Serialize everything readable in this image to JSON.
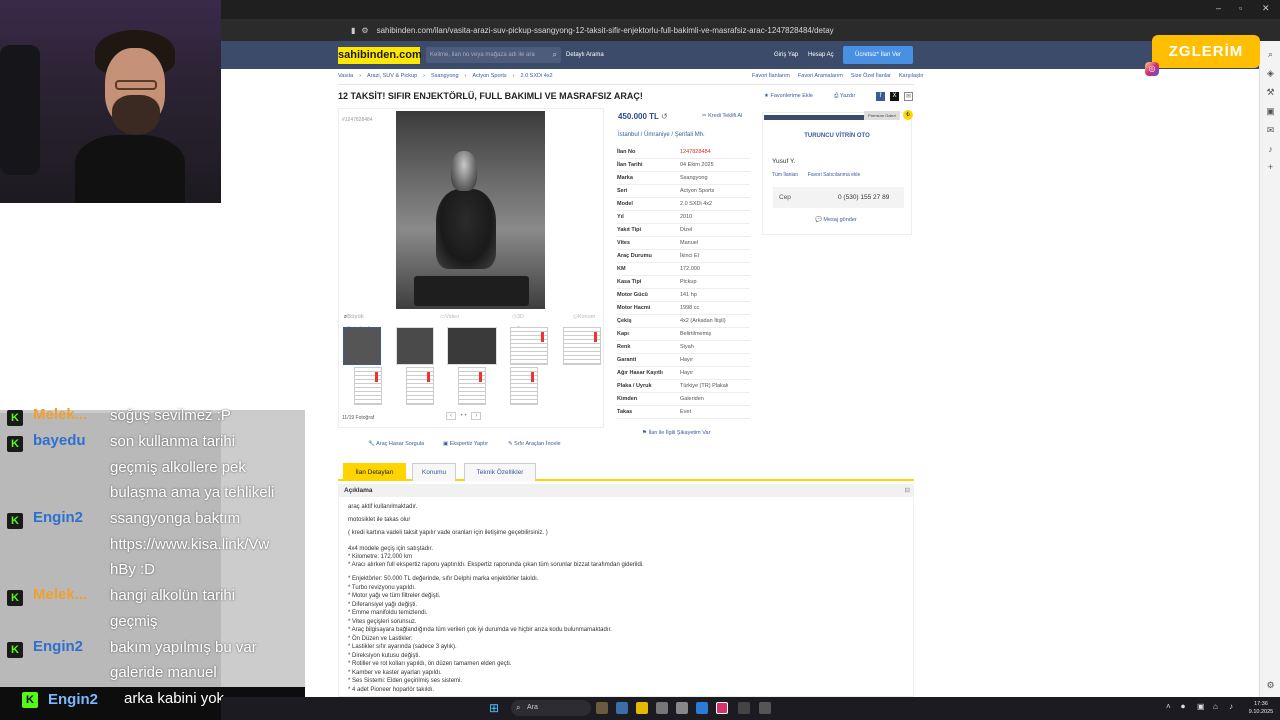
{
  "browser": {
    "url": "sahibinden.com/ilan/vasita-arazi-suv-pickup-ssangyong-12-taksit-sifir-enjektorlu-full-bakimli-ve-masrafsiz-arac-1247828484/detay"
  },
  "header": {
    "logo": "sahibinden.com",
    "search_placeholder": "Kelime, ilan no veya mağaza adı ile ara",
    "detailed_search": "Detaylı Arama",
    "login": "Giriş Yap",
    "register": "Hesap Aç",
    "post_ad": "Ücretsiz* İlan Ver"
  },
  "breadcrumb": [
    "Vasıta",
    "Arazi, SUV & Pickup",
    "Ssangyong",
    "Actyon Sports",
    "2.0 SXDi 4x2"
  ],
  "top_links": [
    "Favori İlanlarım",
    "Favori Aramalarım",
    "Size Özel İlanlar",
    "Karşılaştır"
  ],
  "ad": {
    "title": "12 TAKSİT! SIFIR ENJEKTÖRLÜ, FULL BAKIMLI VE MASRAFSIZ ARAÇ!",
    "add_favorite": "Favorilerime Ekle",
    "print": "Yazdır",
    "small_no": "#1247828484",
    "price": "450.000 TL",
    "credit": "Kredi Teklifi Al",
    "location": "İstanbul  /  Ümraniye  /  Şerifali Mh.",
    "specs": [
      {
        "k": "İlan No",
        "v": "1247828484"
      },
      {
        "k": "İlan Tarihi",
        "v": "04 Ekim 2025"
      },
      {
        "k": "Marka",
        "v": "Ssangyong"
      },
      {
        "k": "Seri",
        "v": "Actyon Sports"
      },
      {
        "k": "Model",
        "v": "2.0 SXDi 4x2"
      },
      {
        "k": "Yıl",
        "v": "2010"
      },
      {
        "k": "Yakıt Tipi",
        "v": "Dizel"
      },
      {
        "k": "Vites",
        "v": "Manuel"
      },
      {
        "k": "Araç Durumu",
        "v": "İkinci El"
      },
      {
        "k": "KM",
        "v": "172.000"
      },
      {
        "k": "Kasa Tipi",
        "v": "Pickup"
      },
      {
        "k": "Motor Gücü",
        "v": "141 hp"
      },
      {
        "k": "Motor Hacmi",
        "v": "1998 cc"
      },
      {
        "k": "Çekiş",
        "v": "4x2 (Arkadan İtişli)"
      },
      {
        "k": "Kapı",
        "v": "Belirtilmemiş"
      },
      {
        "k": "Renk",
        "v": "Siyah"
      },
      {
        "k": "Garanti",
        "v": "Hayır"
      },
      {
        "k": "Ağır Hasar Kayıtlı",
        "v": "Hayır"
      },
      {
        "k": "Plaka / Uyruk",
        "v": "Türkiye (TR) Plakalı"
      },
      {
        "k": "Kimden",
        "v": "Galeriden"
      },
      {
        "k": "Takas",
        "v": "Evet"
      }
    ],
    "complaint": "İlan ile İlgili Şikayetim Var"
  },
  "gallery": {
    "tab_big": "Büyük Fotoğraf",
    "tab_video": "Video",
    "tab_3d": "3D Tur",
    "tab_map": "Konum",
    "count": "11/19 Fotoğraf",
    "tools": [
      "Araç Hasar Sorgula",
      "Ekspertiz Yaptır",
      "Sıfır Araçları İncele"
    ]
  },
  "seller": {
    "premium": "Premium Galeri",
    "store": "TURUNCU VİTRİN OTO",
    "name": "Yusuf Y.",
    "all_ads": "Tüm İlanları",
    "add_fav": "Favori Satıcılarıma ekle",
    "phone_label": "Cep",
    "phone": "0 (530) 155 27 89",
    "message": "Mesaj gönder"
  },
  "tabs": [
    "İlan Detayları",
    "Konumu",
    "Teknik Özellikler"
  ],
  "description": {
    "heading": "Açıklama",
    "lines": [
      "araç aktif kullanılmaktadır.",
      "motosiklet ile takas olur",
      "( kredi kartına vadeli taksit yapılır vade oranları için iletişime geçebilirsiniz. )",
      "4x4 modele geçiş için satıştadır.",
      "* Kilometre: 172.000 km",
      "* Aracı alırken full ekspertiz raporu yaptırıldı. Ekspertiz raporunda çıkan tüm sorunlar bizzat tarafımdan giderildi.",
      "* Enjektörler: 50.000 TL değerinde, sıfır Delphi marka enjektörler takıldı.",
      "* Turbo revizyonu yapıldı.",
      "* Motor yağı ve tüm filtreler değişti.",
      "* Diferansiyel yağı değişti.",
      "* Emme manifoldu temizlendi.",
      "* Vites geçişleri sorunsuz.",
      "* Araç bilgisayara bağlandığında tüm verileri çok iyi durumda ve hiçbir arıza kodu bulunmamaktadır.",
      "* Ön Düzen ve Lastikler:",
      "* Lastikler sıfır ayarında (sadece 3 aylık).",
      "* Direksiyon kutusu değişti.",
      "* Rotiller ve rot kolları yapıldı, ön düzen tamamen elden geçti.",
      "* Kamber ve kaster ayarları yapıldı.",
      "* Ses Sistemi: Elden geçirilmiş ses sistemi.",
      "* 4 adet Pioneer hoparlör takıldı."
    ]
  },
  "overlay": {
    "brand": "ZGLERİM"
  },
  "chat": [
    {
      "user": "Melek...",
      "color": "#f0a030",
      "lines": [
        "soğuş sevilmez :P"
      ]
    },
    {
      "user": "bayedu",
      "color": "#2f6fd0",
      "lines": [
        "son kullanma tarihi",
        "geçmiş alkollere pek",
        "bulaşma ama ya tehlikeli"
      ]
    },
    {
      "user": "Engin2",
      "color": "#2f6fd0",
      "lines": [
        "ssangyonga baktım",
        "https://www.kisa.link/Vw",
        "hBy :D"
      ]
    },
    {
      "user": "Melek...",
      "color": "#f0a030",
      "lines": [
        "hangi alkolün tarihi",
        "geçmiş"
      ]
    },
    {
      "user": "Engin2",
      "color": "#2f6fd0",
      "lines": [
        "bakım yapılmış bu var",
        "galeride manuel"
      ]
    }
  ],
  "chat_last": {
    "user": "Engin2",
    "msg": "arka kabini yok"
  },
  "taskbar": {
    "search": "Ara",
    "time": "17:36",
    "date": "9.10.2025"
  }
}
